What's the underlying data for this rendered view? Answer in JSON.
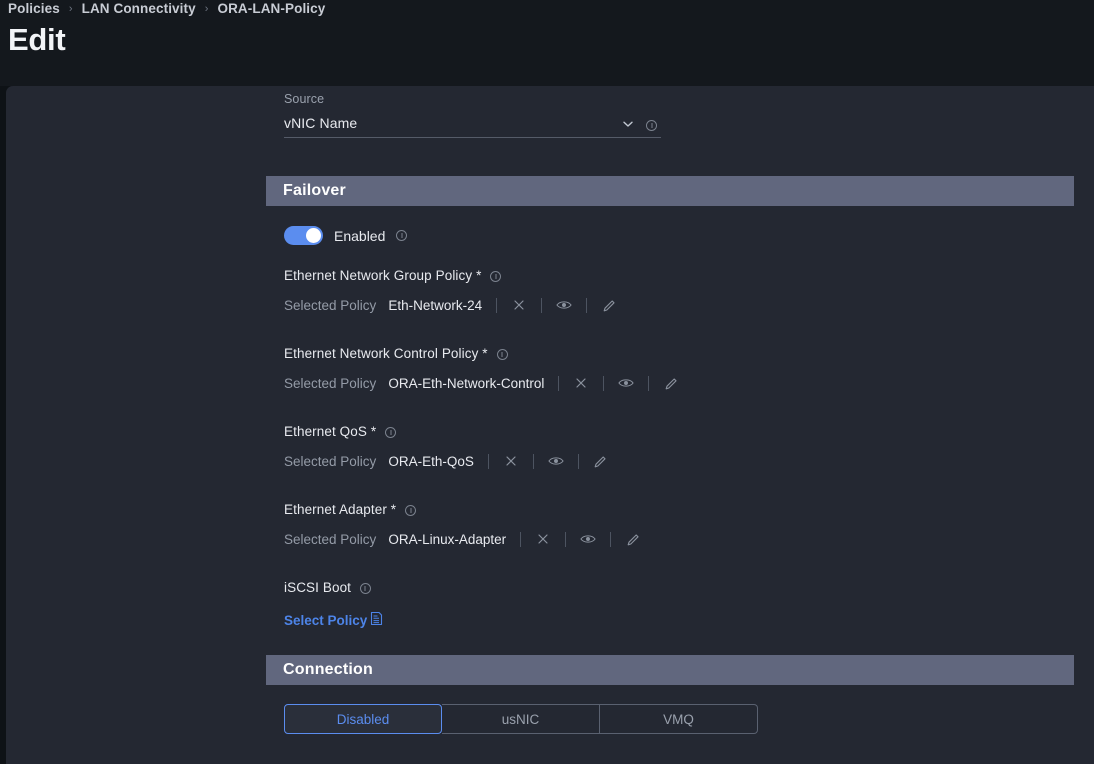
{
  "header": {
    "breadcrumb": [
      {
        "label": "Policies",
        "sep": "›"
      },
      {
        "label": "LAN Connectivity",
        "sep": "›"
      },
      {
        "label": "ORA-LAN-Policy",
        "sep": ""
      }
    ],
    "title": "Edit"
  },
  "source": {
    "label": "Source",
    "value": "vNIC Name",
    "chevron_icon": "chevron-down-icon",
    "info_icon": "info-icon"
  },
  "failover": {
    "section_title": "Failover",
    "toggle": {
      "label": "Enabled",
      "enabled": true,
      "info_icon": "info-icon"
    },
    "policies": [
      {
        "title": "Ethernet Network Group Policy",
        "required": "*",
        "selected_label": "Selected Policy",
        "selected_value": "Eth-Network-24",
        "actions": [
          "clear-icon",
          "view-icon",
          "edit-icon"
        ]
      },
      {
        "title": "Ethernet Network Control Policy",
        "required": "*",
        "selected_label": "Selected Policy",
        "selected_value": "ORA-Eth-Network-Control",
        "actions": [
          "clear-icon",
          "view-icon",
          "edit-icon"
        ]
      },
      {
        "title": "Ethernet QoS",
        "required": "*",
        "selected_label": "Selected Policy",
        "selected_value": "ORA-Eth-QoS",
        "actions": [
          "clear-icon",
          "view-icon",
          "edit-icon"
        ]
      },
      {
        "title": "Ethernet Adapter",
        "required": "*",
        "selected_label": "Selected Policy",
        "selected_value": "ORA-Linux-Adapter",
        "actions": [
          "clear-icon",
          "view-icon",
          "edit-icon"
        ]
      }
    ],
    "iscsi": {
      "title": "iSCSI Boot",
      "required": "",
      "select_link": "Select Policy",
      "link_icon": "policy-list-icon"
    }
  },
  "connection": {
    "section_title": "Connection",
    "options": [
      {
        "label": "Disabled",
        "selected": true
      },
      {
        "label": "usNIC",
        "selected": false
      },
      {
        "label": "VMQ",
        "selected": false
      }
    ]
  },
  "colors": {
    "page_background": "#0e1216",
    "card_background": "#242832",
    "section_bar": "#61677e",
    "accent_blue": "#5b8def",
    "link_blue": "#4d84e8",
    "text_primary": "#e8eaef",
    "text_muted": "#949ba7"
  }
}
